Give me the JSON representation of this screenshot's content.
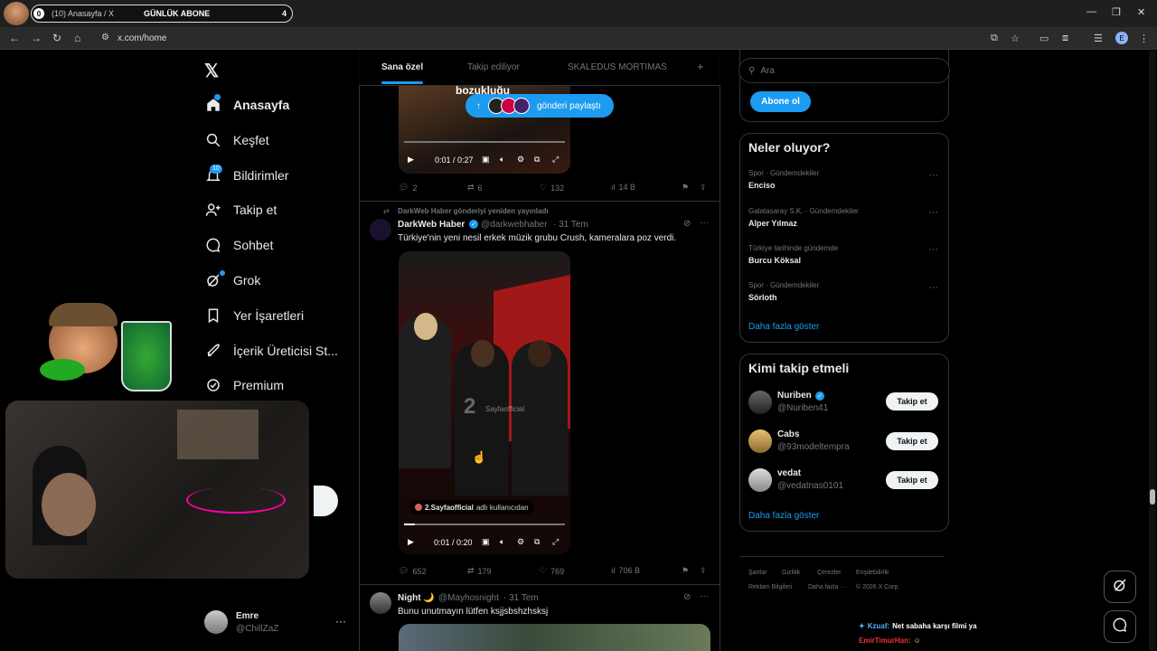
{
  "browser": {
    "tab_count": "0",
    "tab_title": "(10) Anasayfa / X",
    "tab_overlay": "GÜNLÜK ABONE",
    "tab_overlay_num": "4",
    "url": "x.com/home",
    "profile_letter": "E"
  },
  "sidebar": {
    "items": [
      {
        "label": "Anasayfa",
        "icon": "home-icon"
      },
      {
        "label": "Keşfet",
        "icon": "search-icon"
      },
      {
        "label": "Bildirimler",
        "icon": "bell-icon",
        "badge": "10"
      },
      {
        "label": "Takip et",
        "icon": "add-user-icon"
      },
      {
        "label": "Sohbet",
        "icon": "chat-icon"
      },
      {
        "label": "Grok",
        "icon": "grok-icon"
      },
      {
        "label": "Yer İşaretleri",
        "icon": "bookmark-icon"
      },
      {
        "label": "İçerik Üreticisi St...",
        "icon": "rocket-icon"
      },
      {
        "label": "Premium",
        "icon": "verified-icon"
      }
    ],
    "account": {
      "name": "Emre",
      "handle": "@ChillZaZ"
    }
  },
  "timeline": {
    "tabs": [
      "Sana özel",
      "Takip ediliyor",
      "SKALEDUS MORTIMAS"
    ],
    "post1": {
      "video_text": "bozukluğu",
      "time": "0:01 / 0:27",
      "replies": "2",
      "reposts": "6",
      "likes": "132",
      "views": "14 B"
    },
    "share_pill": "gönderi paylaştı",
    "post2": {
      "repost_note": "DarkWeb Haber gönderiyi yeniden yayınladı",
      "name": "DarkWeb Haber",
      "handle": "@darkwebhaber",
      "date": "· 31 Tem",
      "text": "Türkiye'nin yeni nesil erkek müzik grubu Crush, kameralara poz verdi.",
      "watermark": "Sayfaofficial",
      "attribution_user": "2.Sayfaofficial",
      "attribution_suffix": "adlı kullanıcıdan",
      "time": "0:01 / 0:20",
      "replies": "652",
      "reposts": "179",
      "likes": "769",
      "views": "706 B"
    },
    "post3": {
      "name": "Night 🌙",
      "handle": "@Mayhosnight",
      "date": "· 31 Tem",
      "text": "Bunu unutmayın lütfen ksjjsbshzhsksj"
    }
  },
  "right": {
    "search_placeholder": "Ara",
    "subscribe": "Abone ol",
    "trends_title": "Neler oluyor?",
    "trends": [
      {
        "meta": "Spor · Gündemdekiler",
        "name": "Enciso"
      },
      {
        "meta": "Galatasaray S.K. · Gündemdekiler",
        "name": "Alper Yılmaz"
      },
      {
        "meta": "Türkiye tarihinde gündemde",
        "name": "Burcu Köksal"
      },
      {
        "meta": "Spor · Gündemdekiler",
        "name": "Sörloth"
      }
    ],
    "show_more": "Daha fazla göster",
    "who_title": "Kimi takip etmeli",
    "who": [
      {
        "name": "Nuriben",
        "handle": "@Nuriben41",
        "verified": true
      },
      {
        "name": "Cabs",
        "handle": "@93modeltempra",
        "verified": false
      },
      {
        "name": "vedat",
        "handle": "@vedatnas0101",
        "verified": false
      }
    ],
    "follow_label": "Takip et",
    "footer1": [
      "Şartlar",
      "Gizlilik",
      "Çerezler",
      "Erişilebilirlik"
    ],
    "footer2": [
      "Reklam Bilgileri",
      "Daha fazla ···",
      "© 2026 X Corp."
    ]
  },
  "chat": {
    "line1_user": "Kzuaf:",
    "line1_text": "Net sabaha karşı filmi ya",
    "line2_user": "EmirTimurHan:"
  },
  "colors": {
    "accent": "#1d9bf0",
    "bg": "#000000",
    "border": "#2f3336",
    "muted": "#71767b"
  }
}
